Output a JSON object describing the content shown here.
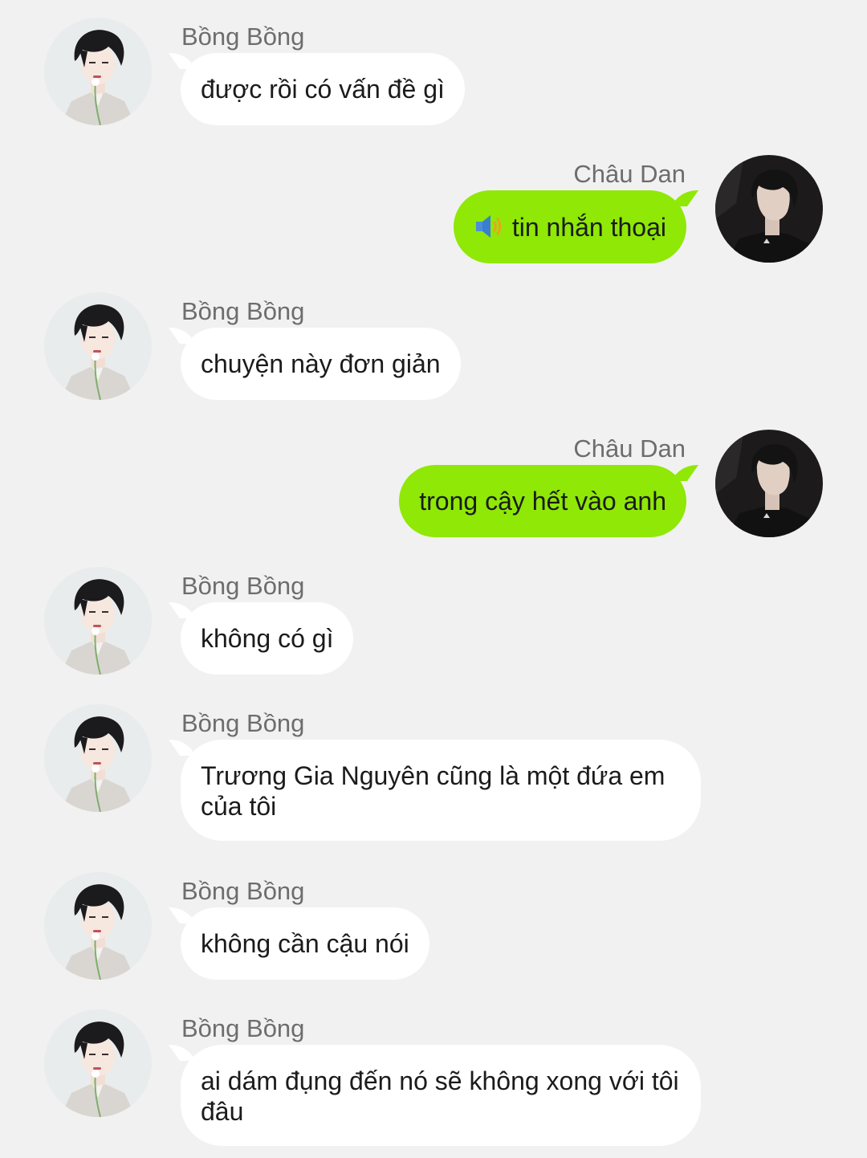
{
  "messages": [
    {
      "side": "left",
      "sender": "Bồng Bồng",
      "text": "được rồi có vấn đề gì"
    },
    {
      "side": "right",
      "sender": "Châu Dan",
      "text": "tin nhắn thoại",
      "icon": "speaker-icon"
    },
    {
      "side": "left",
      "sender": "Bồng Bồng",
      "text": "chuyện này đơn giản"
    },
    {
      "side": "right",
      "sender": "Châu Dan",
      "text": "trong cậy hết vào anh"
    },
    {
      "side": "left",
      "sender": "Bồng Bồng",
      "text": "không có gì"
    },
    {
      "side": "left",
      "sender": "Bồng Bồng",
      "text": "Trương Gia Nguyên cũng là một đứa em của tôi"
    },
    {
      "side": "left",
      "sender": "Bồng Bồng",
      "text": "không cần cậu nói"
    },
    {
      "side": "left",
      "sender": "Bồng Bồng",
      "text": "ai dám đụng đến nó sẽ không xong với tôi đâu"
    }
  ],
  "colors": {
    "background": "#f1f1f1",
    "incoming_bubble": "#ffffff",
    "outgoing_bubble": "#8fe806",
    "sender_name": "#6d6d6d",
    "message_text": "#1b1b1b"
  }
}
